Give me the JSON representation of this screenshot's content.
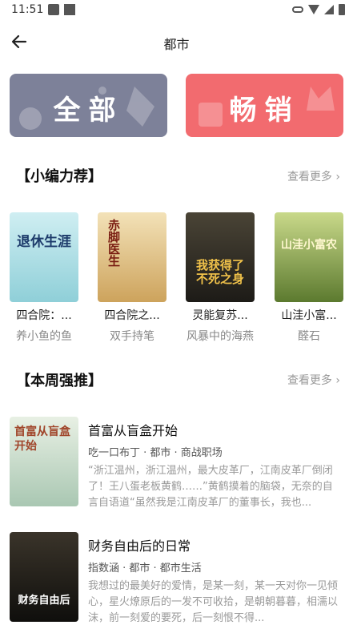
{
  "status": {
    "time": "11:51"
  },
  "header": {
    "title": "都市"
  },
  "banners": {
    "all": "全部",
    "hot": "畅销"
  },
  "section1": {
    "title": "【小编力荐】",
    "more": "查看更多 ›"
  },
  "recommended": [
    {
      "title": "四合院：...",
      "author": "养小鱼的鱼",
      "cover_text": "退休生涯",
      "cover_color": "#9fd7e0"
    },
    {
      "title": "四合院之...",
      "author": "双手持笔",
      "cover_text": "赤脚医生",
      "cover_color": "#d9b46a"
    },
    {
      "title": "灵能复苏...",
      "author": "风暴中的海燕",
      "cover_text": "我获得了不死之身",
      "cover_color": "#2b2a28"
    },
    {
      "title": "山洼小富...",
      "author": "醛石",
      "cover_text": "山洼小富农",
      "cover_color": "#6e8a3a"
    }
  ],
  "section2": {
    "title": "【本周强推】",
    "more": "查看更多 ›"
  },
  "weekly": [
    {
      "title": "首富从盲盒开始",
      "meta": "吃一口布丁 · 都市 · 商战职场",
      "desc": "“浙江温州，浙江温州，最大皮革厂，江南皮革厂倒闭了！王八蛋老板黄鹤……”黄鹤摸着的脑袋，无奈的自言自语道“虽然我是江南皮革厂的董事长，我也...",
      "cover_text": "首富从盲盒开始",
      "cover_color": "#cfe3d6"
    },
    {
      "title": "财务自由后的日常",
      "meta": "指数涵 · 都市 · 都市生活",
      "desc": "我想过的最美好的爱情，是某一刻，某一天对你一见倾心，星火燎原后的一发不可收拾，是朝朝暮暮，相濡以沫，前一刻爱的要死，后一刻恨不得...",
      "cover_text": "财务自由后",
      "cover_color": "#1c1a18"
    }
  ]
}
